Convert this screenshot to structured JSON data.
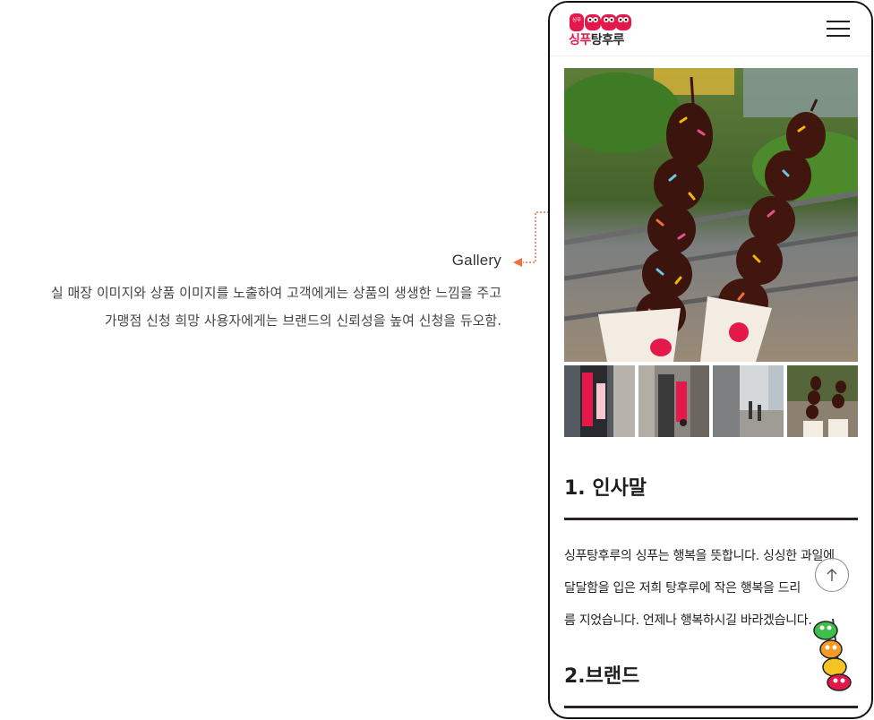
{
  "annotation": {
    "title": "Gallery",
    "description_line1": "실 매장 이미지와 상품 이미지를 노출하여 고객에게는 상품의 생생한 느낌을 주고",
    "description_line2": "가맹점 신청 희망 사용자에게는 브랜드의 신뢰성을 높여 신청을 듀오함.",
    "accent_color": "#f07038"
  },
  "header": {
    "logo_top": "싱푸",
    "logo_red": "싱푸",
    "logo_dark": "탕후루",
    "menu_icon": "hamburger-menu-icon"
  },
  "gallery": {
    "main_image": "chocolate-tanghulu-skewers-photo",
    "thumbnails": [
      "storefront-photo-1",
      "storefront-photo-2",
      "street-photo-3",
      "chocolate-tanghulu-photo-4"
    ]
  },
  "section1": {
    "title": "1. 인사말",
    "line1": "싱푸탕후루의 싱푸는 행복을 뜻합니다. 싱싱한 과일에",
    "line2": "달달함을 입은 저희 탕후루에 작은 행복을 드리",
    "line3": "름 지었습니다. 언제나 행복하시길 바라겠습니다."
  },
  "section2": {
    "title": "2.브랜드"
  },
  "scroll_top_icon": "arrow-up-icon",
  "mascot": "tanghulu-mascot-icon",
  "colors": {
    "brand_red": "#e4184b",
    "rule": "#2b2320"
  }
}
